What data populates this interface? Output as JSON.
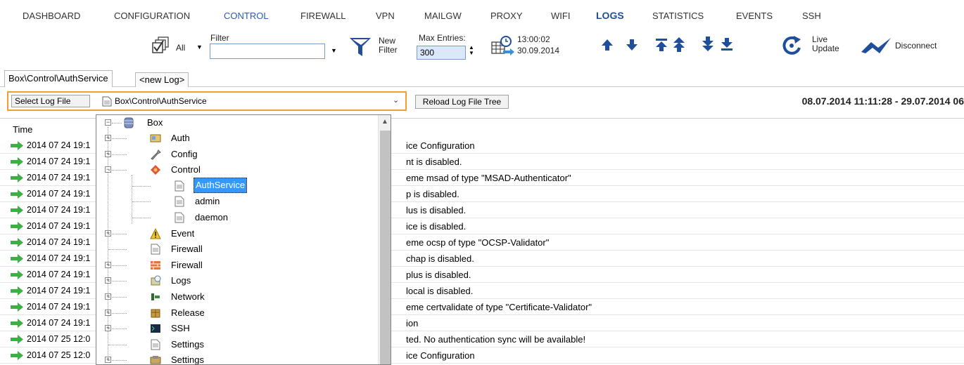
{
  "nav": {
    "items": [
      "DASHBOARD",
      "CONFIGURATION",
      "CONTROL",
      "FIREWALL",
      "VPN",
      "MAILGW",
      "PROXY",
      "WIFI",
      "LOGS",
      "STATISTICS",
      "EVENTS",
      "SSH"
    ]
  },
  "toolbar": {
    "all_label": "All",
    "filter_label": "Filter",
    "filter_value": "",
    "new_filter_line1": "New",
    "new_filter_line2": "Filter",
    "max_entries_label": "Max Entries:",
    "max_entries_value": "300",
    "time_value": "13:00:02",
    "date_value": "30.09.2014",
    "live_update_line1": "Live",
    "live_update_line2": "Update",
    "disconnect_label": "Disconnect"
  },
  "tabs": [
    "Box\\Control\\AuthService",
    "<new Log>"
  ],
  "selector": {
    "select_log_file_label": "Select Log File",
    "current_path": "Box\\Control\\AuthService",
    "reload_label": "Reload Log File Tree",
    "date_range": "08.07.2014 11:11:28 - 29.07.2014 06"
  },
  "log": {
    "time_header": "Time",
    "rows": [
      {
        "ts": "2014 07 24 19:1",
        "msg": "ice Configuration"
      },
      {
        "ts": "2014 07 24 19:1",
        "msg": "nt is disabled."
      },
      {
        "ts": "2014 07 24 19:1",
        "msg": "eme msad of type \"MSAD-Authenticator\""
      },
      {
        "ts": "2014 07 24 19:1",
        "msg": "p is disabled."
      },
      {
        "ts": "2014 07 24 19:1",
        "msg": "lus is disabled."
      },
      {
        "ts": "2014 07 24 19:1",
        "msg": "ice is disabled."
      },
      {
        "ts": "2014 07 24 19:1",
        "msg": "eme ocsp of type \"OCSP-Validator\""
      },
      {
        "ts": "2014 07 24 19:1",
        "msg": "chap is disabled."
      },
      {
        "ts": "2014 07 24 19:1",
        "msg": "plus is disabled."
      },
      {
        "ts": "2014 07 24 19:1",
        "msg": "local is disabled."
      },
      {
        "ts": "2014 07 24 19:1",
        "msg": "eme certvalidate of type \"Certificate-Validator\""
      },
      {
        "ts": "2014 07 24 19:1",
        "msg": "ion"
      },
      {
        "ts": "2014 07 25 12:0",
        "msg": "ted. No authentication sync will be available!"
      },
      {
        "ts": "2014 07 25 12:0",
        "msg": "ice Configuration"
      }
    ]
  },
  "tree": {
    "root": "Box",
    "nodes": [
      {
        "label": "Auth",
        "icon": "auth-icon"
      },
      {
        "label": "Config",
        "icon": "wrench-icon"
      },
      {
        "label": "Control",
        "icon": "control-icon"
      },
      {
        "label": "AuthService",
        "icon": "file-icon"
      },
      {
        "label": "admin",
        "icon": "file-icon"
      },
      {
        "label": "daemon",
        "icon": "file-icon"
      },
      {
        "label": "Event",
        "icon": "warning-icon"
      },
      {
        "label": "Firewall",
        "icon": "file-icon"
      },
      {
        "label": "Firewall",
        "icon": "firewall-icon"
      },
      {
        "label": "Logs",
        "icon": "logs-icon"
      },
      {
        "label": "Network",
        "icon": "network-icon"
      },
      {
        "label": "Release",
        "icon": "package-icon"
      },
      {
        "label": "SSH",
        "icon": "terminal-icon"
      },
      {
        "label": "Settings",
        "icon": "file-icon"
      },
      {
        "label": "Settings",
        "icon": "settings-icon"
      }
    ]
  }
}
